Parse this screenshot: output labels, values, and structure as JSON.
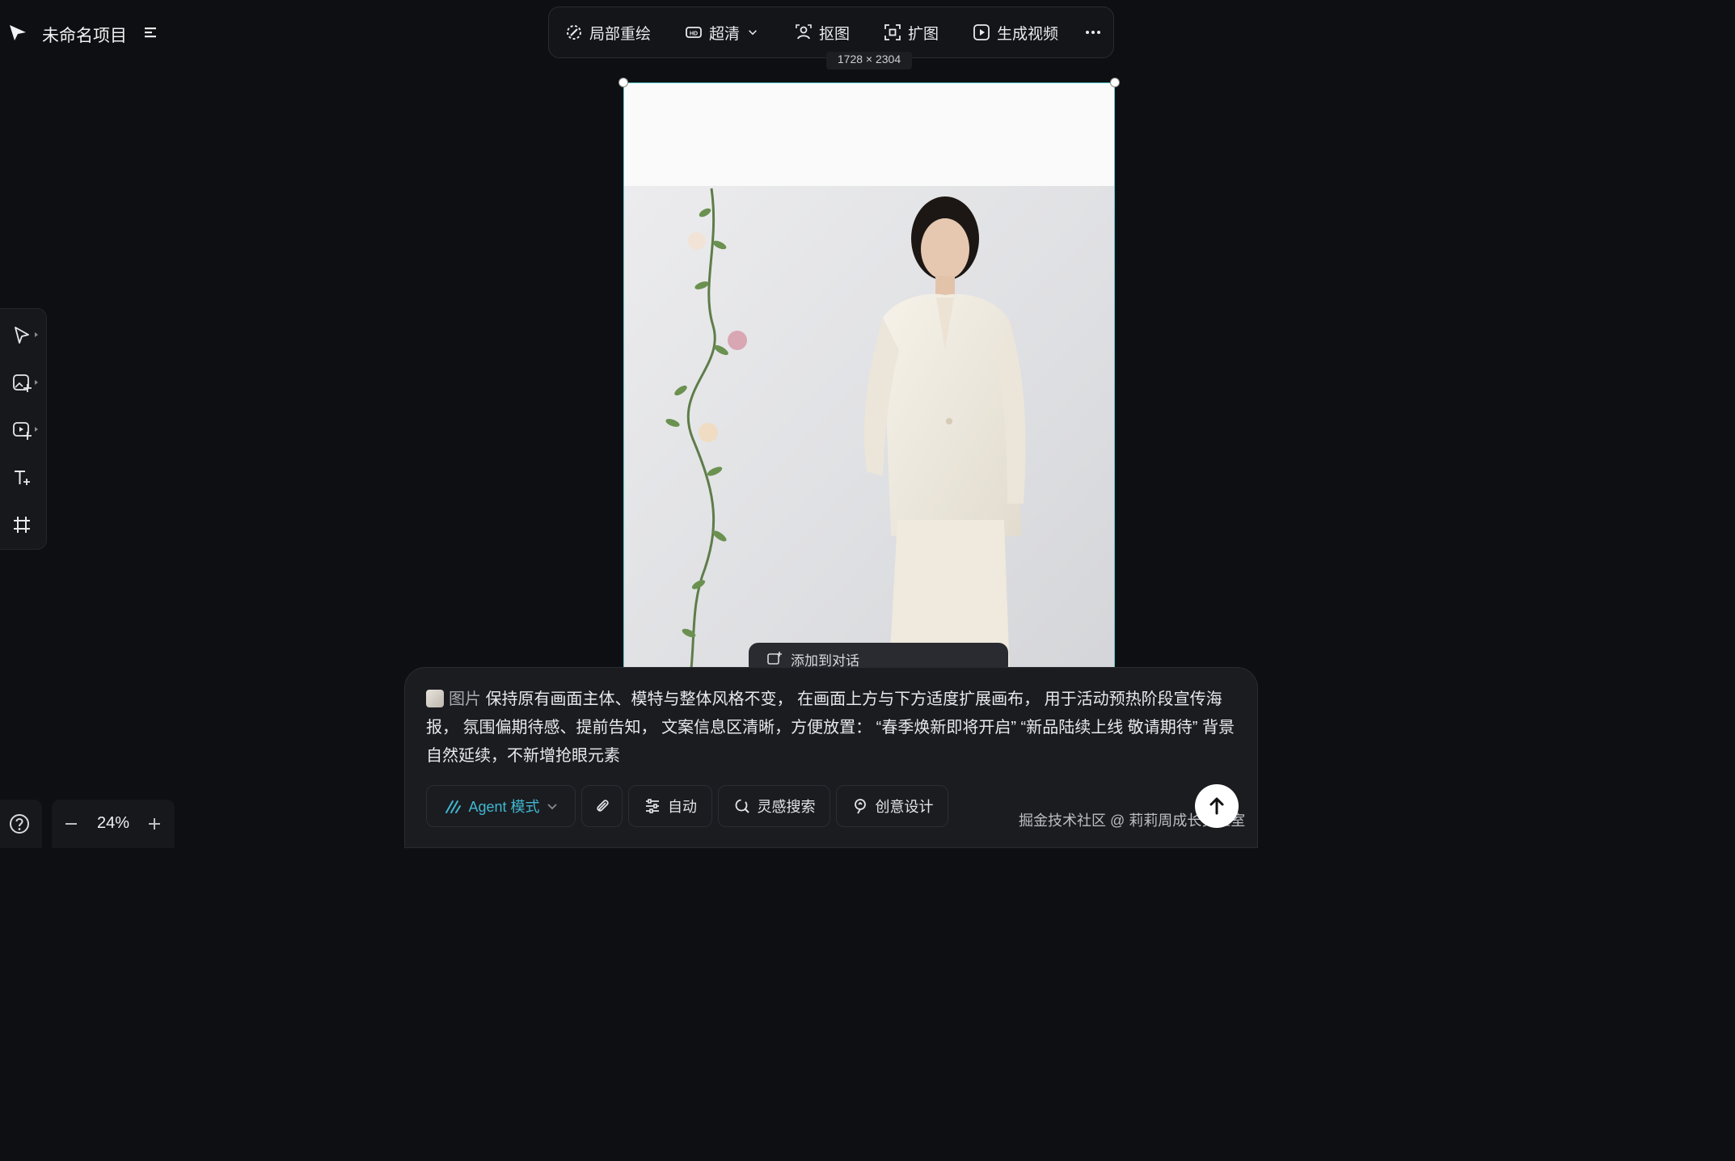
{
  "header": {
    "project_title": "未命名项目"
  },
  "toolbar": {
    "items": [
      {
        "label": "局部重绘",
        "icon": "inpaint-icon"
      },
      {
        "label": "超清",
        "icon": "hd-icon"
      },
      {
        "label": "抠图",
        "icon": "cutout-icon"
      },
      {
        "label": "扩图",
        "icon": "expand-icon"
      },
      {
        "label": "生成视频",
        "icon": "video-play-icon"
      }
    ],
    "dimensions": "1728 × 2304"
  },
  "canvas": {
    "float_bar_label": "添加到对话"
  },
  "zoom": {
    "value": "24%"
  },
  "prompt": {
    "chip": "图片",
    "text": "保持原有画面主体、模特与整体风格不变， 在画面上方与下方适度扩展画布， 用于活动预热阶段宣传海报， 氛围偏期待感、提前告知， 文案信息区清晰，方便放置： “春季焕新即将开启” “新品陆续上线 敬请期待” 背景自然延续，不新增抢眼元素"
  },
  "controls": {
    "agent_mode": "Agent 模式",
    "auto": "自动",
    "inspiration_search": "灵感搜索",
    "creative_design": "创意设计"
  },
  "watermark": "掘金技术社区 @ 莉莉周成长实验室",
  "colors": {
    "accent": "#3fb8d1",
    "selection": "#56c9d2",
    "background": "#0e0f12"
  }
}
